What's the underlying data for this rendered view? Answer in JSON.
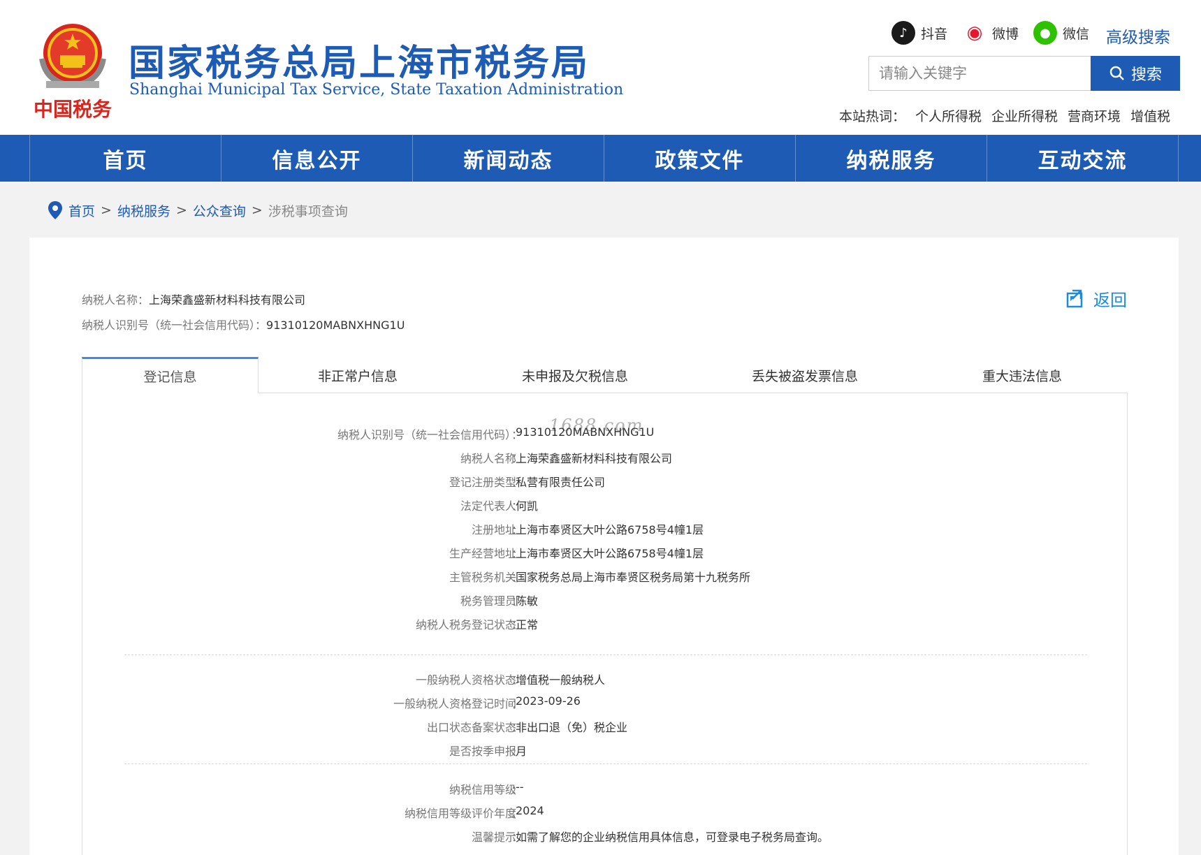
{
  "header": {
    "title_cn": "国家税务总局上海市税务局",
    "title_en": "Shanghai Municipal Tax Service, State Taxation Administration",
    "emblem_text": "中国税务",
    "social": [
      {
        "label": "抖音",
        "icon": "douyin-icon",
        "color": "#1a1a1a"
      },
      {
        "label": "微博",
        "icon": "weibo-icon",
        "color": "#e6162d"
      },
      {
        "label": "微信",
        "icon": "wechat-icon",
        "color": "#2dc100"
      }
    ],
    "advanced_search": "高级搜索",
    "search_placeholder": "请输入关键字",
    "search_button": "搜索",
    "hotwords_label": "本站热词：",
    "hotwords": [
      "个人所得税",
      "企业所得税",
      "营商环境",
      "增值税"
    ]
  },
  "nav": [
    "首页",
    "信息公开",
    "新闻动态",
    "政策文件",
    "纳税服务",
    "互动交流"
  ],
  "breadcrumb": {
    "items": [
      "首页",
      "纳税服务",
      "公众查询"
    ],
    "separator": ">",
    "current": "涉税事项查询"
  },
  "summary": {
    "name_label": "纳税人名称：",
    "name": "上海荣鑫盛新材料科技有限公司",
    "id_label": "纳税人识别号（统一社会信用代码）：",
    "id": "91310120MABNXHNG1U",
    "back": "返回"
  },
  "tabs": [
    "登记信息",
    "非正常户信息",
    "未申报及欠税信息",
    "丢失被盗发票信息",
    "重大违法信息"
  ],
  "watermark": "1688.com",
  "registration": [
    {
      "label": "纳税人识别号（统一社会信用代码）",
      "value": "91310120MABNXHNG1U"
    },
    {
      "label": "纳税人名称",
      "value": "上海荣鑫盛新材料科技有限公司"
    },
    {
      "label": "登记注册类型",
      "value": "私营有限责任公司"
    },
    {
      "label": "法定代表人",
      "value": "何凯"
    },
    {
      "label": "注册地址",
      "value": "上海市奉贤区大叶公路6758号4幢1层"
    },
    {
      "label": "生产经营地址",
      "value": "上海市奉贤区大叶公路6758号4幢1层"
    },
    {
      "label": "主管税务机关",
      "value": "国家税务总局上海市奉贤区税务局第十九税务所"
    },
    {
      "label": "税务管理员",
      "value": "陈敏"
    },
    {
      "label": "纳税人税务登记状态",
      "value": "正常"
    }
  ],
  "qualification": [
    {
      "label": "一般纳税人资格状态",
      "value": "增值税一般纳税人"
    },
    {
      "label": "一般纳税人资格登记时间",
      "value": "2023-09-26"
    },
    {
      "label": "出口状态备案状态",
      "value": "非出口退（免）税企业"
    },
    {
      "label": "是否按季申报",
      "value": "月"
    }
  ],
  "credit": [
    {
      "label": "纳税信用等级",
      "value": "--"
    },
    {
      "label": "纳税信用等级评价年度",
      "value": "2024"
    },
    {
      "label": "温馨提示",
      "value": "如需了解您的企业纳税信用具体信息，可登录电子税务局查询。"
    }
  ],
  "colors": {
    "brand_blue": "#1e5bb4",
    "tab_accent": "#3a8ee6",
    "back_blue": "#1e8ae0"
  }
}
